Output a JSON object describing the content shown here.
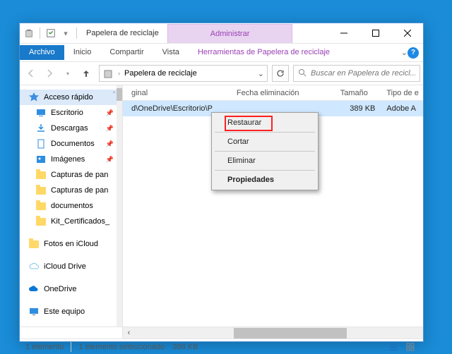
{
  "titlebar": {
    "title": "Papelera de reciclaje",
    "manage": "Administrar"
  },
  "ribbon": {
    "file": "Archivo",
    "home": "Inicio",
    "share": "Compartir",
    "view": "Vista",
    "tools": "Herramientas de Papelera de reciclaje"
  },
  "address": {
    "location": "Papelera de reciclaje",
    "search_placeholder": "Buscar en Papelera de recicl..."
  },
  "nav": {
    "quick_access": "Acceso rápido",
    "items": [
      {
        "label": "Escritorio",
        "icon": "desktop"
      },
      {
        "label": "Descargas",
        "icon": "downloads"
      },
      {
        "label": "Documentos",
        "icon": "documents"
      },
      {
        "label": "Imágenes",
        "icon": "pictures"
      },
      {
        "label": "Capturas de pan",
        "icon": "folder"
      },
      {
        "label": "Capturas de pan",
        "icon": "folder"
      },
      {
        "label": "documentos",
        "icon": "folder"
      },
      {
        "label": "Kit_Certificados_",
        "icon": "folder"
      }
    ],
    "photos_icloud": "Fotos en iCloud",
    "icloud_drive": "iCloud Drive",
    "onedrive": "OneDrive",
    "this_pc": "Este equipo"
  },
  "columns": {
    "c1": "ginal",
    "c2": "Fecha eliminación",
    "c3": "Tamaño",
    "c4": "Tipo de e"
  },
  "row": {
    "path": "d\\OneDrive\\Escritorio\\P",
    "date": "",
    "size": "389 KB",
    "type": "Adobe A"
  },
  "context": {
    "restore": "Restaurar",
    "cut": "Cortar",
    "delete": "Eliminar",
    "properties": "Propiedades"
  },
  "status": {
    "count": "1 elemento",
    "selected": "1 elemento seleccionado",
    "size": "388 KB"
  }
}
